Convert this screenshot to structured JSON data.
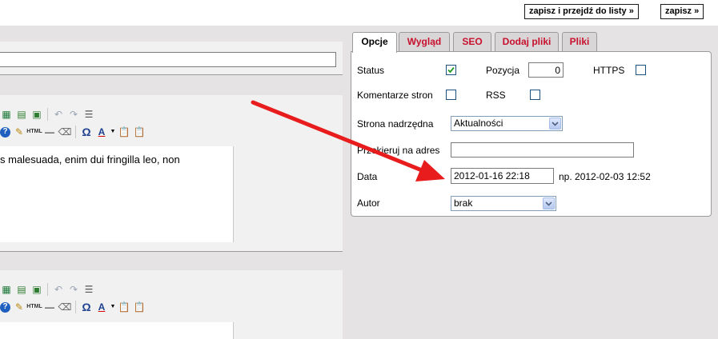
{
  "toolbar": {
    "save_and_list_label": "zapisz i przejdź do listy »",
    "save_label": "zapisz »"
  },
  "editor": {
    "first_text": "s malesuada, enim dui fringilla leo, non",
    "toolbar_html_label": "HTML",
    "toolbar_omega_label": "Ω",
    "toolbar_font_color_label": "A"
  },
  "tabs": [
    {
      "label": "Opcje",
      "active": true
    },
    {
      "label": "Wygląd",
      "active": false
    },
    {
      "label": "SEO",
      "active": false
    },
    {
      "label": "Dodaj pliki",
      "active": false
    },
    {
      "label": "Pliki",
      "active": false
    }
  ],
  "options": {
    "status_label": "Status",
    "status_checked": true,
    "position_label": "Pozycja",
    "position_value": "0",
    "https_label": "HTTPS",
    "https_checked": false,
    "comments_label": "Komentarze stron",
    "comments_checked": false,
    "rss_label": "RSS",
    "rss_checked": false,
    "parent_label": "Strona nadrzędna",
    "parent_value": "Aktualności",
    "redirect_label": "Przekieruj na adres",
    "redirect_value": "",
    "date_label": "Data",
    "date_value": "2012-01-16 22:18",
    "date_hint": "np. 2012-02-03 12:52",
    "author_label": "Autor",
    "author_value": "brak"
  },
  "colors": {
    "tab_inactive_text": "#c8102e",
    "arrow": "#e81c1c",
    "checkbox_border": "#1c5180"
  }
}
